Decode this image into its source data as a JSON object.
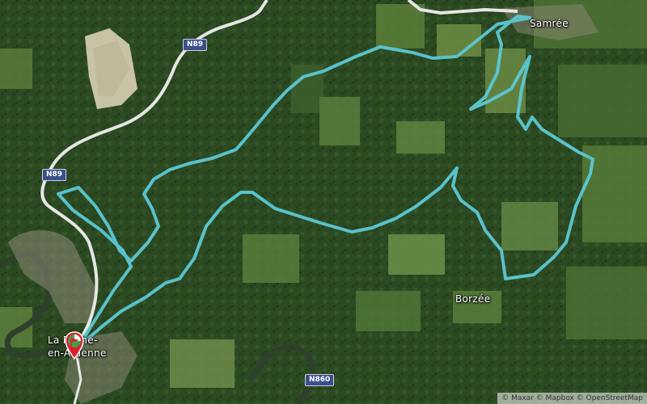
{
  "map": {
    "towns": [
      {
        "id": "samree",
        "label": "Samrée"
      },
      {
        "id": "borzee",
        "label": "Borzée"
      },
      {
        "id": "laroche-1",
        "label": "La Roche-"
      },
      {
        "id": "laroche-2",
        "label": "en-Ardenne"
      }
    ],
    "roads": [
      {
        "id": "n89-north",
        "label": "N89"
      },
      {
        "id": "n89-west",
        "label": "N89"
      },
      {
        "id": "n860",
        "label": "N860"
      }
    ],
    "route_color": "#5cc8d6",
    "marker": {
      "start_color": "#3fa34d",
      "end_color": "#e11d2a"
    },
    "attribution": "© Maxar © Mapbox © OpenStreetMap"
  }
}
